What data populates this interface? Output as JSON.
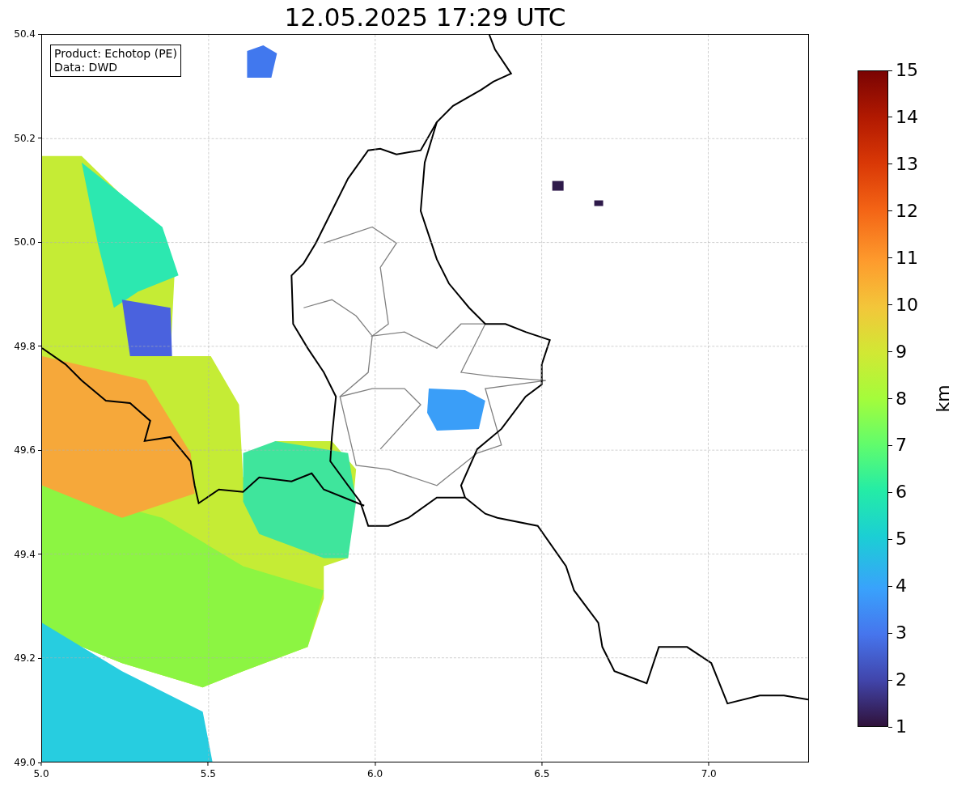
{
  "title": "12.05.2025 17:29 UTC",
  "legend": [
    "Product: Echotop (PE)",
    "Data: DWD"
  ],
  "x_ticks": [
    "5.0",
    "5.5",
    "6.0",
    "6.5",
    "7.0"
  ],
  "y_ticks": [
    "50.4",
    "50.2",
    "50.0",
    "49.8",
    "49.6",
    "49.4",
    "49.2",
    "49.0"
  ],
  "colorbar": {
    "label": "km",
    "ticks": [
      "15",
      "14",
      "13",
      "12",
      "11",
      "10",
      "9",
      "8",
      "7",
      "6",
      "5",
      "4",
      "3",
      "2",
      "1"
    ]
  }
}
